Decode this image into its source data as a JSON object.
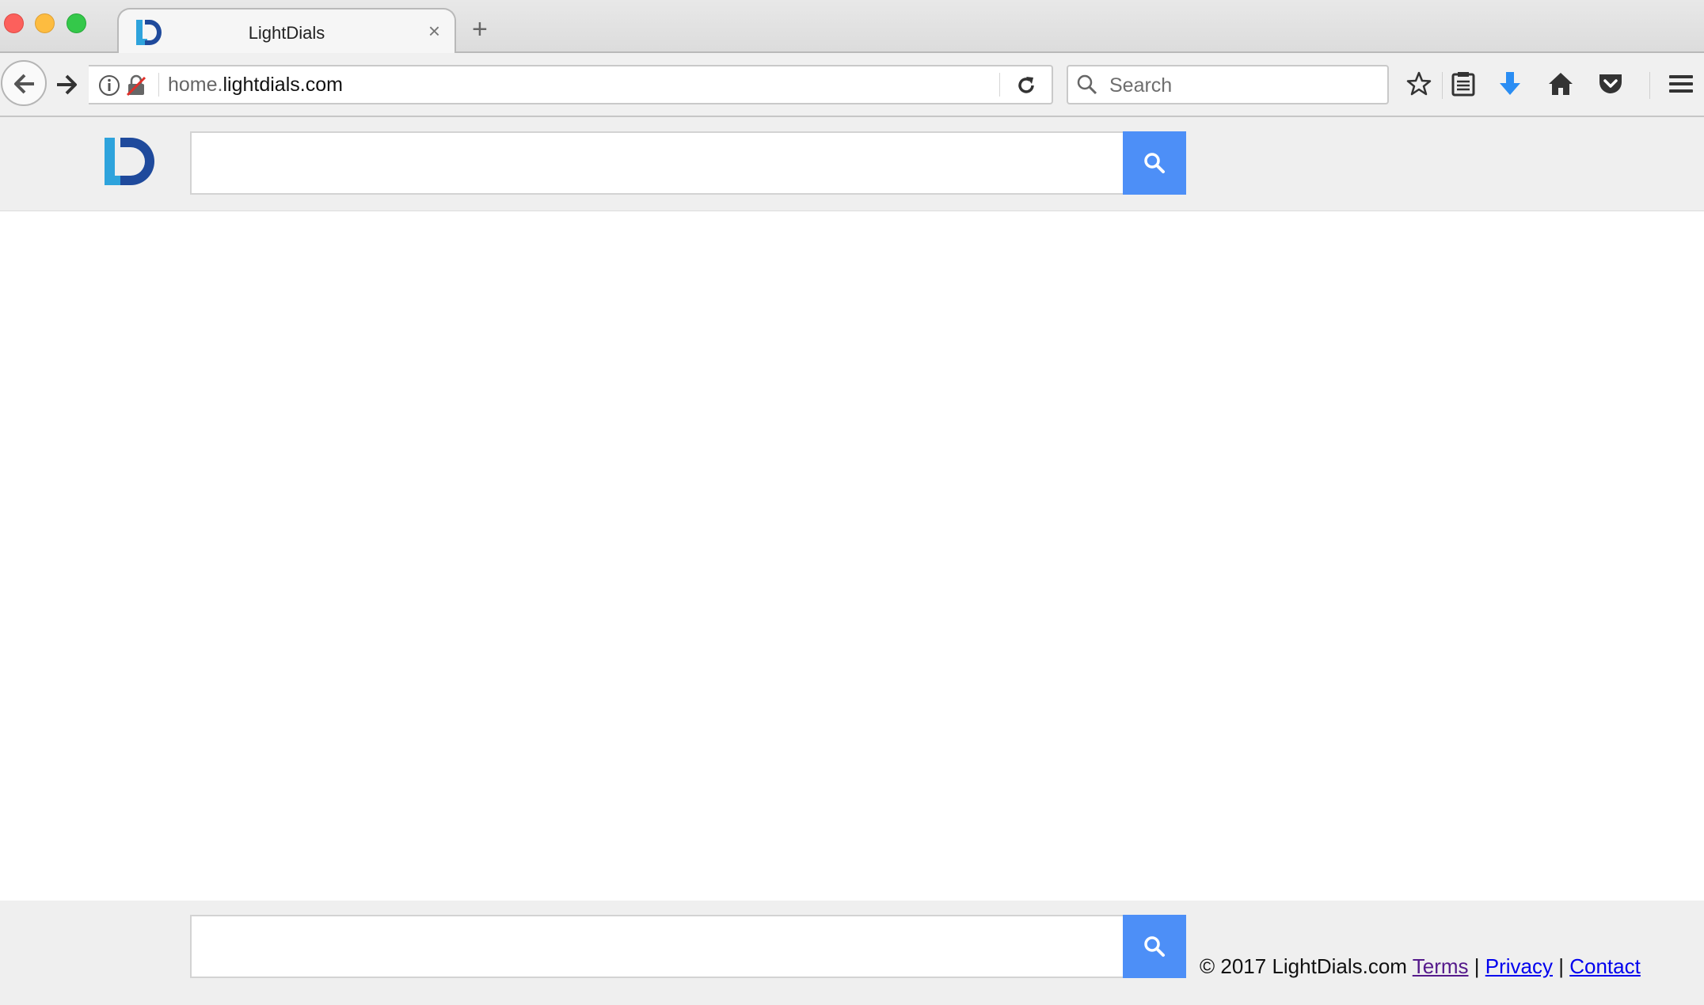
{
  "browser": {
    "tab": {
      "title": "LightDials",
      "close_glyph": "×"
    },
    "new_tab_glyph": "+",
    "url": {
      "prefix": "home.",
      "domain": "lightdials.com"
    },
    "search_placeholder": "Search",
    "toolbar_icons": [
      "back-arrow-icon",
      "forward-arrow-icon",
      "info-icon",
      "insecure-lock-icon",
      "reload-icon",
      "search-icon",
      "bookmark-star-icon",
      "reader-list-icon",
      "download-icon",
      "home-icon",
      "pocket-icon",
      "hamburger-menu-icon"
    ],
    "colors": {
      "download_accent": "#2a8df3"
    }
  },
  "page": {
    "logo_colors": {
      "light": "#2ea3dc",
      "dark": "#1f4a9c"
    },
    "search_button_color": "#4d8ff7",
    "footer": {
      "copyright": "© 2017 LightDials.com",
      "links": {
        "terms": "Terms",
        "privacy": "Privacy",
        "contact": "Contact"
      },
      "separator": "|"
    }
  }
}
